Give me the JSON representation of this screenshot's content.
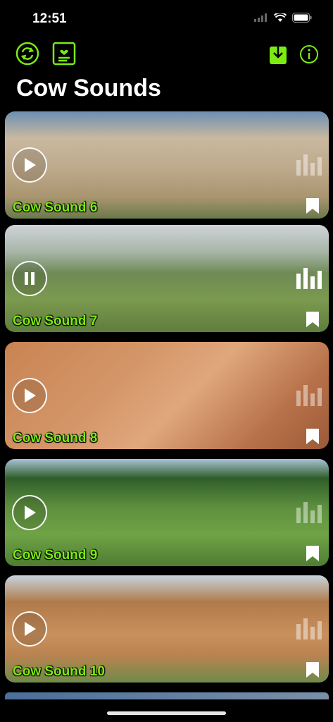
{
  "status": {
    "time": "12:51"
  },
  "toolbar": {
    "accent": "#7CEB12",
    "icons": [
      "repeat-icon",
      "list-icon",
      "download-icon",
      "info-icon"
    ]
  },
  "page": {
    "title": "Cow Sounds"
  },
  "cards": [
    {
      "label": "Cow Sound 6",
      "state": "play",
      "bg": "linear-gradient(180deg,#6b8fb3 0%,#c9b9a0 25%,#bda88a 55%,#a9956f 80%,#6a7a4a 100%)"
    },
    {
      "label": "Cow Sound 7",
      "state": "pause",
      "bg": "linear-gradient(180deg,#cfd3d8 0%,#a8b6a9 25%,#6f8a55 45%,#7b9a4e 70%,#5f7d3d 100%)"
    },
    {
      "label": "Cow Sound 8",
      "state": "play",
      "bg": "linear-gradient(135deg,#c98352 0%,#d49668 35%,#e0a77c 55%,#b8724a 80%,#9a5a38 100%)"
    },
    {
      "label": "Cow Sound 9",
      "state": "play",
      "bg": "linear-gradient(180deg,#a9c2d6 0%,#2f5e2a 18%,#5e8f3e 45%,#6fa346 70%,#4f7d32 100%)"
    },
    {
      "label": "Cow Sound 10",
      "state": "play",
      "bg": "linear-gradient(180deg,#c7d3dc 0%,#b07a4a 25%,#c9905c 55%,#b88350 75%,#6f8a4a 100%)"
    }
  ]
}
